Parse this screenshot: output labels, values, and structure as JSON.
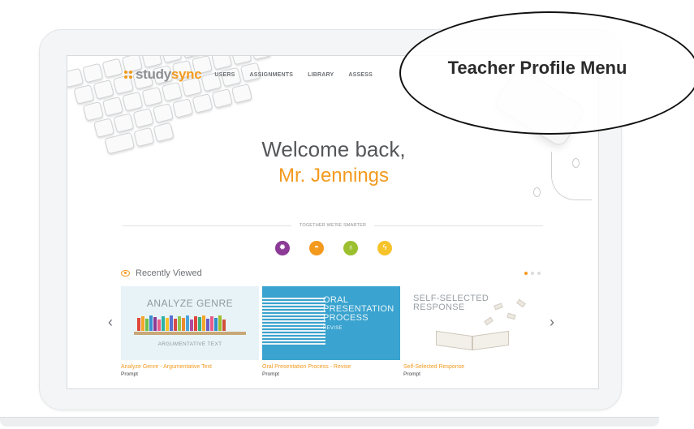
{
  "brand": {
    "logo_part1": "study",
    "logo_part2": "sync",
    "accent_color": "#f39a1e"
  },
  "nav": {
    "items": [
      "USERS",
      "ASSIGNMENTS",
      "LIBRARY",
      "ASSESS"
    ]
  },
  "welcome": {
    "greeting": "Welcome back,",
    "name": "Mr. Jennings"
  },
  "divider": {
    "text": "TOGETHER WE'RE SMARTER"
  },
  "feature_icons": [
    {
      "name": "burst-icon",
      "color": "#8b3a96"
    },
    {
      "name": "sun-icon",
      "color": "#f39a1e"
    },
    {
      "name": "lightbulb-icon",
      "color": "#9cbf2f"
    },
    {
      "name": "lightning-icon",
      "color": "#f6c32b"
    }
  ],
  "recent": {
    "title": "Recently Viewed",
    "cards": [
      {
        "image_title": "ANALYZE GENRE",
        "image_subtitle": "ARGUMENTATIVE TEXT",
        "title": "Analyze Genre - Argumentative Text",
        "type": "Prompt"
      },
      {
        "image_line1": "ORAL",
        "image_line2": "PRESENTATION",
        "image_line3": "PROCESS",
        "image_sub": "REVISE",
        "title": "Oral Presentation Process - Revise",
        "type": "Prompt"
      },
      {
        "image_line1": "SELF-SELECTED",
        "image_line2": "RESPONSE",
        "title": "Self-Selected Response",
        "type": "Prompt"
      }
    ],
    "prev_label": "‹",
    "next_label": "›"
  },
  "callout": {
    "label": "Teacher Profile Menu"
  }
}
